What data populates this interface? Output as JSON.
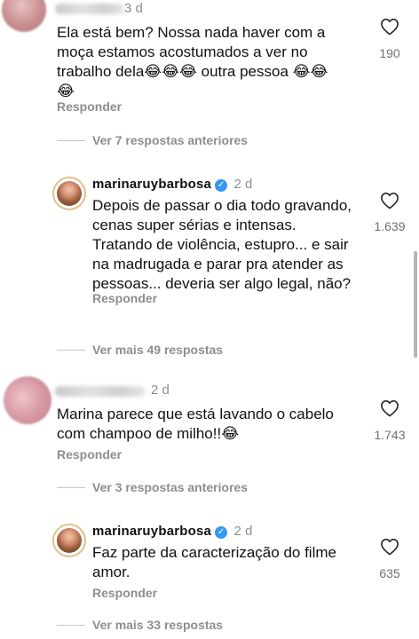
{
  "comments": [
    {
      "time": "3 d",
      "text_lines": [
        "Ela está bem? Nossa nada haver com a",
        "moça estamos acostumados a ver no",
        "trabalho dela😂😂😂 outra pessoa 😂😂",
        "😂"
      ],
      "likes": "190",
      "reply_label": "Responder",
      "toggle_label": "Ver 7 respostas anteriores"
    },
    {
      "username": "marinaruybarbosa",
      "time": "2 d",
      "text_lines": [
        "Depois de passar o dia todo gravando,",
        "cenas super sérias e intensas.",
        "Tratando de violência, estupro... e sair",
        "na madrugada e parar pra atender as",
        "pessoas... deveria ser algo legal, não?"
      ],
      "likes": "1.639",
      "reply_label": "Responder",
      "toggle_label": "Ver mais 49 respostas"
    },
    {
      "time": "2 d",
      "text_lines": [
        "Marina parece que está lavando o cabelo",
        "com champoo de milho!!😂"
      ],
      "likes": "1.743",
      "reply_label": "Responder",
      "toggle_label": "Ver 3 respostas anteriores"
    },
    {
      "username": "marinaruybarbosa",
      "time": "2 d",
      "text_lines": [
        "Faz parte da caracterização do filme",
        "amor."
      ],
      "likes": "635",
      "reply_label": "Responder",
      "toggle_label": "Ver mais 33 respostas"
    }
  ],
  "icons": {
    "like": "heart-outline-icon",
    "verified": "verified-badge-icon"
  },
  "colors": {
    "secondary_text": "#8e8e8e",
    "verified_blue": "#3897f0"
  }
}
